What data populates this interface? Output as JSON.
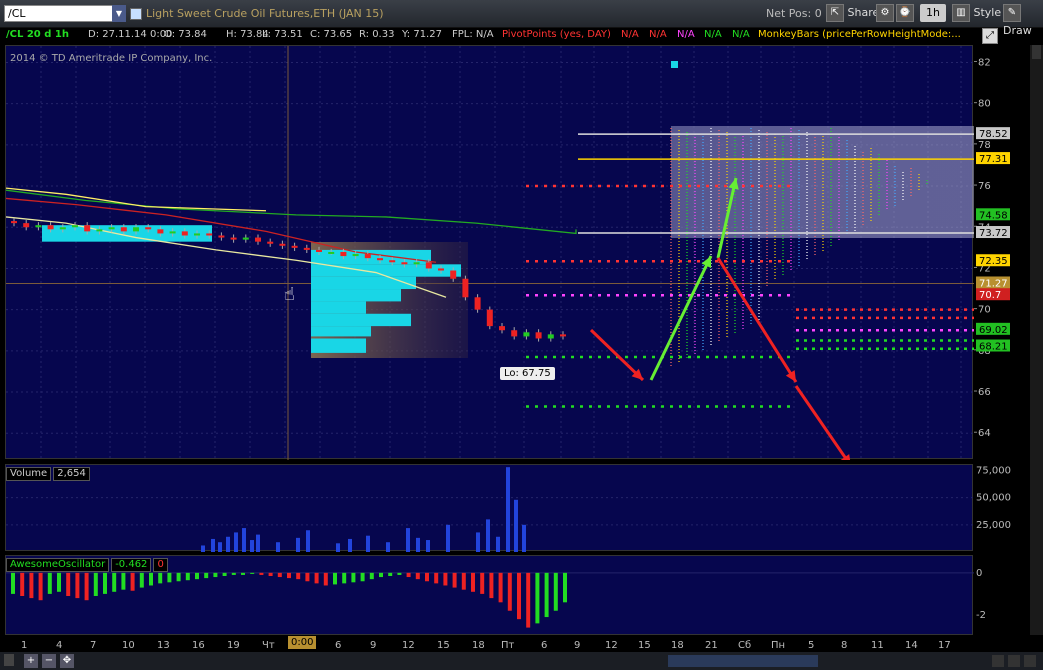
{
  "toolbar": {
    "symbol": "/CL",
    "description": "Light Sweet Crude Oil Futures,ETH (JAN 15)",
    "net_pos": "Net Pos: 0",
    "share": "Share",
    "period": "1h",
    "style": "Style",
    "drawing": "Draw"
  },
  "header": {
    "study": "/CL 20 d 1h",
    "date": "D: 27.11.14 0:00",
    "open": "O: 73.84",
    "high": "H: 73.84",
    "low": "L: 73.51",
    "close": "C: 73.65",
    "range": "R: 0.33",
    "y": "Y: 71.27",
    "fpl": "FPL: N/A",
    "pivot": "PivotPoints (yes, DAY)",
    "na": [
      "N/A",
      "N/A",
      "N/A",
      "N/A",
      "N/A"
    ],
    "monkey": "MonkeyBars (pricePerRowHeightMode:..."
  },
  "copyright": "2014 © TD Ameritrade IP Company, Inc.",
  "lo_label": "Lo: 67.75",
  "volume": {
    "label": "Volume",
    "value": "2,654"
  },
  "ao": {
    "label": "AwesomeOscillator",
    "value": "-0.462",
    "value2": "0"
  },
  "time_marker": "0:00",
  "price_labels": [
    {
      "text": "78.52",
      "bg": "#c8c8c8",
      "fg": "#000000"
    },
    {
      "text": "77.31",
      "bg": "#ffd400",
      "fg": "#000000"
    },
    {
      "text": "74.58",
      "bg": "#22c022",
      "fg": "#000000"
    },
    {
      "text": "73.72",
      "bg": "#c8c8c8",
      "fg": "#000000"
    },
    {
      "text": "72.35",
      "bg": "#ffd400",
      "fg": "#000000"
    },
    {
      "text": "71.27",
      "bg": "#b89030",
      "fg": "#ffffff"
    },
    {
      "text": "70.7",
      "bg": "#d02020",
      "fg": "#ffffff"
    },
    {
      "text": "69.02",
      "bg": "#22c022",
      "fg": "#000000"
    },
    {
      "text": "68.21",
      "bg": "#22c022",
      "fg": "#000000"
    }
  ],
  "chart_data": [
    {
      "type": "candlestick",
      "y_ticks": [
        64,
        66,
        68,
        70,
        72,
        74,
        76,
        78,
        80,
        82
      ],
      "ylim": [
        62.7,
        82.8
      ],
      "x_ticks": [
        "1",
        "4",
        "7",
        "10",
        "13",
        "16",
        "19",
        "Чт",
        "3",
        "6",
        "9",
        "12",
        "15",
        "18",
        "Пт",
        "6",
        "9",
        "12",
        "15",
        "18",
        "21",
        "Сб",
        "Пн",
        "5",
        "8",
        "11",
        "14",
        "17"
      ],
      "series": [
        {
          "values": [
            75.8,
            75.3,
            74.9,
            74.6,
            74.5,
            74.2,
            73.7,
            73.9
          ]
        },
        {
          "values": [
            75.9,
            75.6,
            75.0,
            74.8
          ]
        },
        {
          "values": [
            75.4,
            75.1,
            74.6,
            73.8,
            72.8,
            72.3
          ]
        },
        {
          "values": [
            74.5,
            74.2,
            73.5,
            72.9,
            72.4,
            71.8,
            70.6
          ]
        }
      ],
      "levels": [
        {
          "name": "white",
          "value": 78.52
        },
        {
          "name": "yellow",
          "value": 77.31
        },
        {
          "name": "white2",
          "value": 73.72
        },
        {
          "name": "red-pivot-1",
          "value": 76.0
        },
        {
          "name": "red-pivot-2",
          "value": 72.35
        },
        {
          "name": "magenta-pivot",
          "value": 70.7
        },
        {
          "name": "green-pivot-1",
          "value": 67.7
        },
        {
          "name": "green-pivot-2",
          "value": 65.3
        }
      ]
    },
    {
      "type": "bar",
      "y_ticks": [
        "75,000",
        "50,000",
        "25,000"
      ],
      "ylim": [
        0,
        80000
      ],
      "values": [
        6000,
        12000,
        9000,
        14000,
        18000,
        22000,
        11000,
        16000,
        9000,
        13000,
        20000,
        8000,
        12000,
        15000,
        9000,
        22000,
        13000,
        11000,
        25000,
        18000,
        30000,
        14000,
        78000,
        48000,
        25000
      ]
    },
    {
      "type": "bar",
      "y_ticks": [
        "0",
        "-2"
      ],
      "ylim": [
        -3.0,
        0.8
      ],
      "values": [
        -1.0,
        -1.1,
        -1.2,
        -1.3,
        -1.0,
        -0.9,
        -1.1,
        -1.2,
        -1.3,
        -1.1,
        -1.0,
        -0.9,
        -0.8,
        -0.85,
        -0.7,
        -0.6,
        -0.5,
        -0.45,
        -0.4,
        -0.35,
        -0.3,
        -0.25,
        -0.2,
        -0.15,
        -0.1,
        -0.1,
        -0.05,
        -0.1,
        -0.15,
        -0.2,
        -0.25,
        -0.3,
        -0.4,
        -0.5,
        -0.6,
        -0.55,
        -0.5,
        -0.45,
        -0.4,
        -0.3,
        -0.2,
        -0.15,
        -0.1,
        -0.2,
        -0.3,
        -0.4,
        -0.5,
        -0.6,
        -0.7,
        -0.8,
        -0.9,
        -1.0,
        -1.2,
        -1.4,
        -1.8,
        -2.2,
        -2.6,
        -2.4,
        -2.1,
        -1.8,
        -1.4
      ]
    }
  ]
}
